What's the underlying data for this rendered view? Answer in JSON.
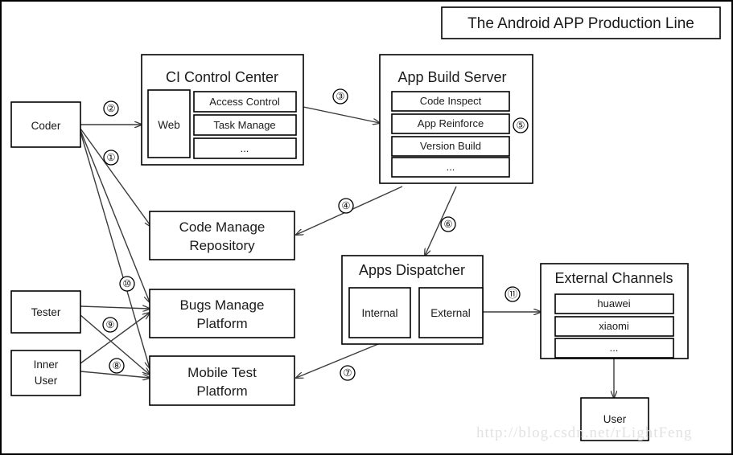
{
  "title": "The Android APP Production Line",
  "watermark": "http://blog.csdn.net/rLightFeng",
  "actors": {
    "coder": "Coder",
    "tester": "Tester",
    "inner_user_line1": "Inner",
    "inner_user_line2": "User",
    "user": "User"
  },
  "ci_control_center": {
    "title": "CI Control Center",
    "web": "Web",
    "items": [
      "Access Control",
      "Task Manage",
      "..."
    ]
  },
  "app_build_server": {
    "title": "App Build Server",
    "items": [
      "Code Inspect",
      "App Reinforce",
      "Version Build",
      "..."
    ]
  },
  "code_manage_repository": {
    "line1": "Code Manage",
    "line2": "Repository"
  },
  "bugs_manage_platform": {
    "line1": "Bugs Manage",
    "line2": "Platform"
  },
  "mobile_test_platform": {
    "line1": "Mobile Test",
    "line2": "Platform"
  },
  "apps_dispatcher": {
    "title": "Apps Dispatcher",
    "internal": "Internal",
    "external": "External"
  },
  "external_channels": {
    "title": "External Channels",
    "items": [
      "huawei",
      "xiaomi",
      "..."
    ]
  },
  "flow_labels": {
    "n1": "①",
    "n2": "②",
    "n3": "③",
    "n4": "④",
    "n5": "⑤",
    "n6": "⑥",
    "n7": "⑦",
    "n8": "⑧",
    "n9": "⑨",
    "n10": "⑩",
    "n11": "⑪"
  },
  "colors": {
    "stroke": "#000000",
    "line": "#3b3b3b",
    "background": "#ffffff",
    "watermark": "#e2e2e2"
  }
}
